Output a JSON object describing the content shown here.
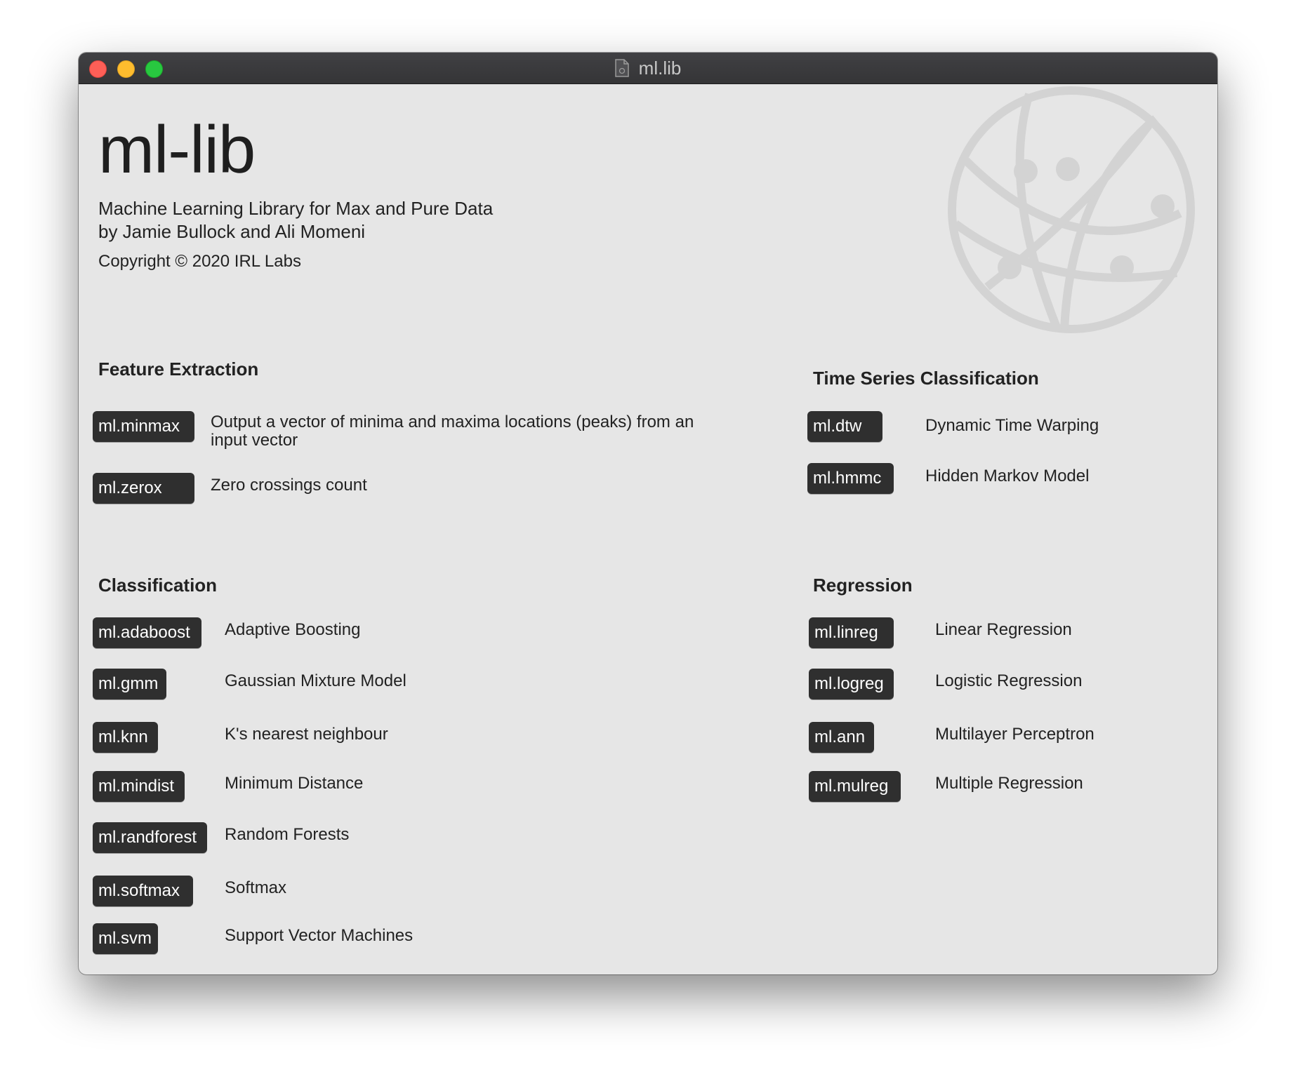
{
  "window": {
    "title": "ml.lib"
  },
  "header": {
    "title": "ml-lib",
    "subtitle_line1": "Machine Learning Library for Max and Pure Data",
    "subtitle_line2": "by Jamie Bullock and Ali Momeni",
    "copyright": "Copyright © 2020 IRL Labs"
  },
  "sections": {
    "feature_extraction": {
      "title": "Feature Extraction",
      "items": [
        {
          "object": "ml.minmax",
          "description": "Output a vector of minima and maxima locations (peaks) from an input vector"
        },
        {
          "object": "ml.zerox",
          "description": "Zero crossings count"
        }
      ]
    },
    "time_series": {
      "title": "Time Series Classification",
      "items": [
        {
          "object": "ml.dtw",
          "description": "Dynamic Time Warping"
        },
        {
          "object": "ml.hmmc",
          "description": "Hidden Markov Model"
        }
      ]
    },
    "classification": {
      "title": "Classification",
      "items": [
        {
          "object": "ml.adaboost",
          "description": "Adaptive Boosting"
        },
        {
          "object": "ml.gmm",
          "description": "Gaussian Mixture Model"
        },
        {
          "object": "ml.knn",
          "description": "K's nearest neighbour"
        },
        {
          "object": "ml.mindist",
          "description": "Minimum Distance"
        },
        {
          "object": "ml.randforest",
          "description": "Random Forests"
        },
        {
          "object": "ml.softmax",
          "description": "Softmax"
        },
        {
          "object": "ml.svm",
          "description": "Support Vector Machines"
        }
      ]
    },
    "regression": {
      "title": "Regression",
      "items": [
        {
          "object": "ml.linreg",
          "description": "Linear Regression"
        },
        {
          "object": "ml.logreg",
          "description": "Logistic Regression"
        },
        {
          "object": "ml.ann",
          "description": "Multilayer Perceptron"
        },
        {
          "object": "ml.mulreg",
          "description": "Multiple Regression"
        }
      ]
    }
  }
}
